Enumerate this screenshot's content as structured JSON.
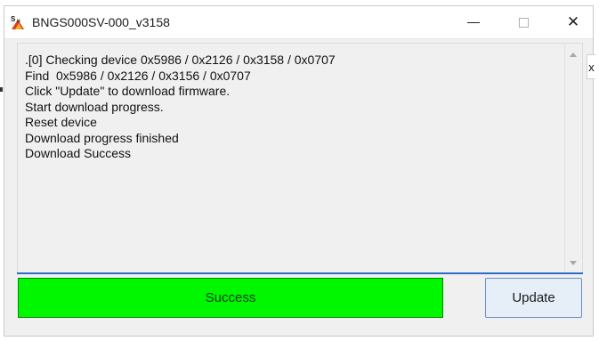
{
  "window": {
    "title": "BNGS000SV-000_v3158"
  },
  "controls": {
    "close_glyph": "✕"
  },
  "log": {
    "lines": [
      ".[0] Checking device 0x5986 / 0x2126 / 0x3158 / 0x0707",
      "Find  0x5986 / 0x2126 / 0x3156 / 0x0707",
      "Click \"Update\" to download firmware.",
      "Start download progress.",
      "Reset device",
      "Download progress finished",
      "Download Success"
    ]
  },
  "status": {
    "text": "Success",
    "color": "#00f700"
  },
  "actions": {
    "update_label": "Update"
  },
  "edge": {
    "side_x_label": "x"
  }
}
